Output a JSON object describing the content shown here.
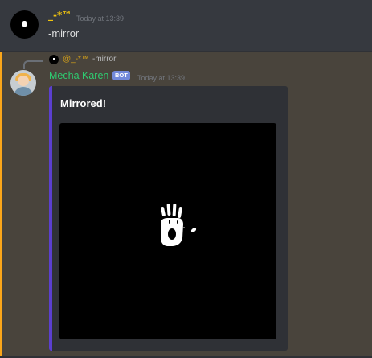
{
  "messages": [
    {
      "author": "_-*™",
      "timestamp": "Today at 13:39",
      "content": "-mirror",
      "author_color": "#f1c40f"
    },
    {
      "author": "Mecha Karen",
      "badge": "BOT",
      "timestamp": "Today at 13:39",
      "author_color": "#2ecc71",
      "mentioned": true,
      "reply": {
        "author": "@_-*™",
        "content": "-mirror"
      },
      "embed": {
        "title": "Mirrored!",
        "accent_color": "#5b3fcf",
        "image": "handprint-image"
      }
    }
  ],
  "colors": {
    "background": "#36393f",
    "mention_highlight": "#49443c",
    "mention_bar": "#faa61a",
    "bot_badge": "#7289da"
  }
}
